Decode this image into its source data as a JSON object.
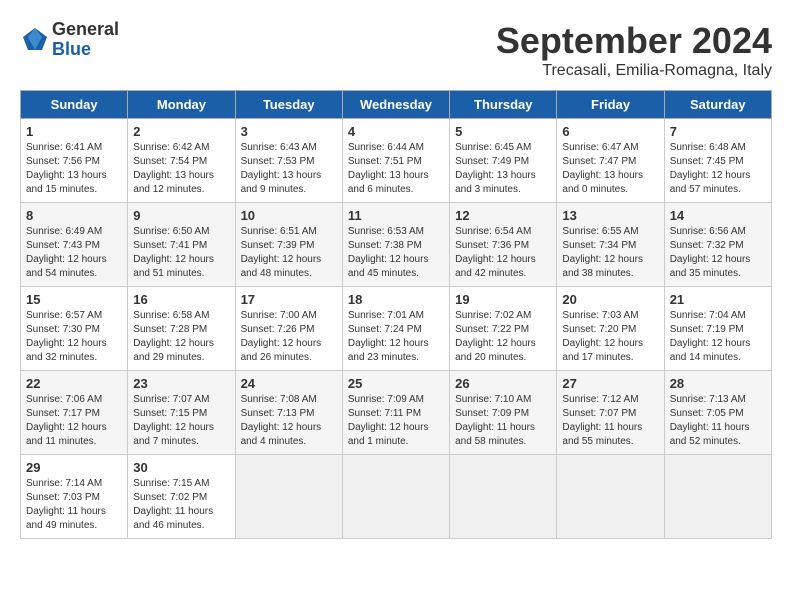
{
  "header": {
    "logo_general": "General",
    "logo_blue": "Blue",
    "month_title": "September 2024",
    "location": "Trecasali, Emilia-Romagna, Italy"
  },
  "days_of_week": [
    "Sunday",
    "Monday",
    "Tuesday",
    "Wednesday",
    "Thursday",
    "Friday",
    "Saturday"
  ],
  "weeks": [
    [
      {
        "day": "1",
        "info": "Sunrise: 6:41 AM\nSunset: 7:56 PM\nDaylight: 13 hours\nand 15 minutes."
      },
      {
        "day": "2",
        "info": "Sunrise: 6:42 AM\nSunset: 7:54 PM\nDaylight: 13 hours\nand 12 minutes."
      },
      {
        "day": "3",
        "info": "Sunrise: 6:43 AM\nSunset: 7:53 PM\nDaylight: 13 hours\nand 9 minutes."
      },
      {
        "day": "4",
        "info": "Sunrise: 6:44 AM\nSunset: 7:51 PM\nDaylight: 13 hours\nand 6 minutes."
      },
      {
        "day": "5",
        "info": "Sunrise: 6:45 AM\nSunset: 7:49 PM\nDaylight: 13 hours\nand 3 minutes."
      },
      {
        "day": "6",
        "info": "Sunrise: 6:47 AM\nSunset: 7:47 PM\nDaylight: 13 hours\nand 0 minutes."
      },
      {
        "day": "7",
        "info": "Sunrise: 6:48 AM\nSunset: 7:45 PM\nDaylight: 12 hours\nand 57 minutes."
      }
    ],
    [
      {
        "day": "8",
        "info": "Sunrise: 6:49 AM\nSunset: 7:43 PM\nDaylight: 12 hours\nand 54 minutes."
      },
      {
        "day": "9",
        "info": "Sunrise: 6:50 AM\nSunset: 7:41 PM\nDaylight: 12 hours\nand 51 minutes."
      },
      {
        "day": "10",
        "info": "Sunrise: 6:51 AM\nSunset: 7:39 PM\nDaylight: 12 hours\nand 48 minutes."
      },
      {
        "day": "11",
        "info": "Sunrise: 6:53 AM\nSunset: 7:38 PM\nDaylight: 12 hours\nand 45 minutes."
      },
      {
        "day": "12",
        "info": "Sunrise: 6:54 AM\nSunset: 7:36 PM\nDaylight: 12 hours\nand 42 minutes."
      },
      {
        "day": "13",
        "info": "Sunrise: 6:55 AM\nSunset: 7:34 PM\nDaylight: 12 hours\nand 38 minutes."
      },
      {
        "day": "14",
        "info": "Sunrise: 6:56 AM\nSunset: 7:32 PM\nDaylight: 12 hours\nand 35 minutes."
      }
    ],
    [
      {
        "day": "15",
        "info": "Sunrise: 6:57 AM\nSunset: 7:30 PM\nDaylight: 12 hours\nand 32 minutes."
      },
      {
        "day": "16",
        "info": "Sunrise: 6:58 AM\nSunset: 7:28 PM\nDaylight: 12 hours\nand 29 minutes."
      },
      {
        "day": "17",
        "info": "Sunrise: 7:00 AM\nSunset: 7:26 PM\nDaylight: 12 hours\nand 26 minutes."
      },
      {
        "day": "18",
        "info": "Sunrise: 7:01 AM\nSunset: 7:24 PM\nDaylight: 12 hours\nand 23 minutes."
      },
      {
        "day": "19",
        "info": "Sunrise: 7:02 AM\nSunset: 7:22 PM\nDaylight: 12 hours\nand 20 minutes."
      },
      {
        "day": "20",
        "info": "Sunrise: 7:03 AM\nSunset: 7:20 PM\nDaylight: 12 hours\nand 17 minutes."
      },
      {
        "day": "21",
        "info": "Sunrise: 7:04 AM\nSunset: 7:19 PM\nDaylight: 12 hours\nand 14 minutes."
      }
    ],
    [
      {
        "day": "22",
        "info": "Sunrise: 7:06 AM\nSunset: 7:17 PM\nDaylight: 12 hours\nand 11 minutes."
      },
      {
        "day": "23",
        "info": "Sunrise: 7:07 AM\nSunset: 7:15 PM\nDaylight: 12 hours\nand 7 minutes."
      },
      {
        "day": "24",
        "info": "Sunrise: 7:08 AM\nSunset: 7:13 PM\nDaylight: 12 hours\nand 4 minutes."
      },
      {
        "day": "25",
        "info": "Sunrise: 7:09 AM\nSunset: 7:11 PM\nDaylight: 12 hours\nand 1 minute."
      },
      {
        "day": "26",
        "info": "Sunrise: 7:10 AM\nSunset: 7:09 PM\nDaylight: 11 hours\nand 58 minutes."
      },
      {
        "day": "27",
        "info": "Sunrise: 7:12 AM\nSunset: 7:07 PM\nDaylight: 11 hours\nand 55 minutes."
      },
      {
        "day": "28",
        "info": "Sunrise: 7:13 AM\nSunset: 7:05 PM\nDaylight: 11 hours\nand 52 minutes."
      }
    ],
    [
      {
        "day": "29",
        "info": "Sunrise: 7:14 AM\nSunset: 7:03 PM\nDaylight: 11 hours\nand 49 minutes."
      },
      {
        "day": "30",
        "info": "Sunrise: 7:15 AM\nSunset: 7:02 PM\nDaylight: 11 hours\nand 46 minutes."
      },
      {
        "day": "",
        "info": ""
      },
      {
        "day": "",
        "info": ""
      },
      {
        "day": "",
        "info": ""
      },
      {
        "day": "",
        "info": ""
      },
      {
        "day": "",
        "info": ""
      }
    ]
  ]
}
